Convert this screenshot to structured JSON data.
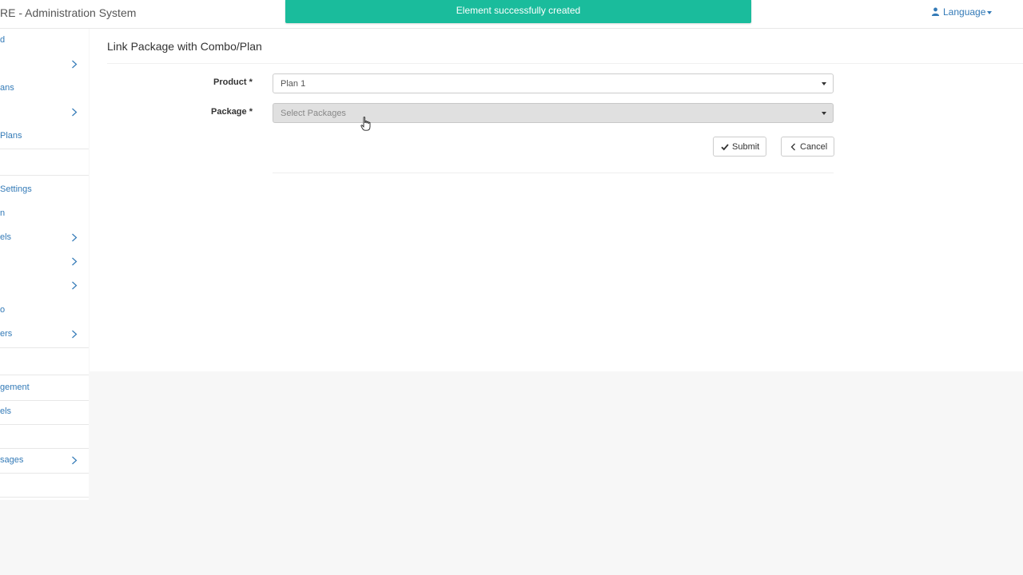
{
  "header": {
    "app_title": "RE - Administration System",
    "language_label": "Language",
    "icons": {
      "user": "user-icon",
      "dropdown": "caret-down-icon"
    }
  },
  "toast": {
    "message": "Element successfully created",
    "color": "#1abc9c"
  },
  "sidebar": {
    "items": [
      {
        "label": "d",
        "has_chevron": false
      },
      {
        "label": "",
        "has_chevron": true
      },
      {
        "label": "ans",
        "has_chevron": false
      },
      {
        "label": "",
        "has_chevron": true
      },
      {
        "label": "Plans",
        "has_chevron": false
      },
      {
        "label": "",
        "has_chevron": false
      },
      {
        "label": "Settings",
        "has_chevron": false
      },
      {
        "label": "n",
        "has_chevron": false
      },
      {
        "label": "els",
        "has_chevron": true
      },
      {
        "label": "",
        "has_chevron": true
      },
      {
        "label": "",
        "has_chevron": true
      },
      {
        "label": "o",
        "has_chevron": false
      },
      {
        "label": "ers",
        "has_chevron": true
      },
      {
        "label": "",
        "has_chevron": false
      },
      {
        "label": "gement",
        "has_chevron": false
      },
      {
        "label": "els",
        "has_chevron": false
      },
      {
        "label": "",
        "has_chevron": false
      },
      {
        "label": "sages",
        "has_chevron": true
      },
      {
        "label": "",
        "has_chevron": false
      }
    ]
  },
  "main": {
    "title": "Link Package with Combo/Plan",
    "form": {
      "product": {
        "label": "Product *",
        "value": "Plan 1"
      },
      "package": {
        "label": "Package *",
        "placeholder": "Select Packages"
      },
      "submit_label": "Submit",
      "cancel_label": "Cancel"
    }
  },
  "colors": {
    "accent": "#337ab7",
    "success": "#1abc9c"
  }
}
